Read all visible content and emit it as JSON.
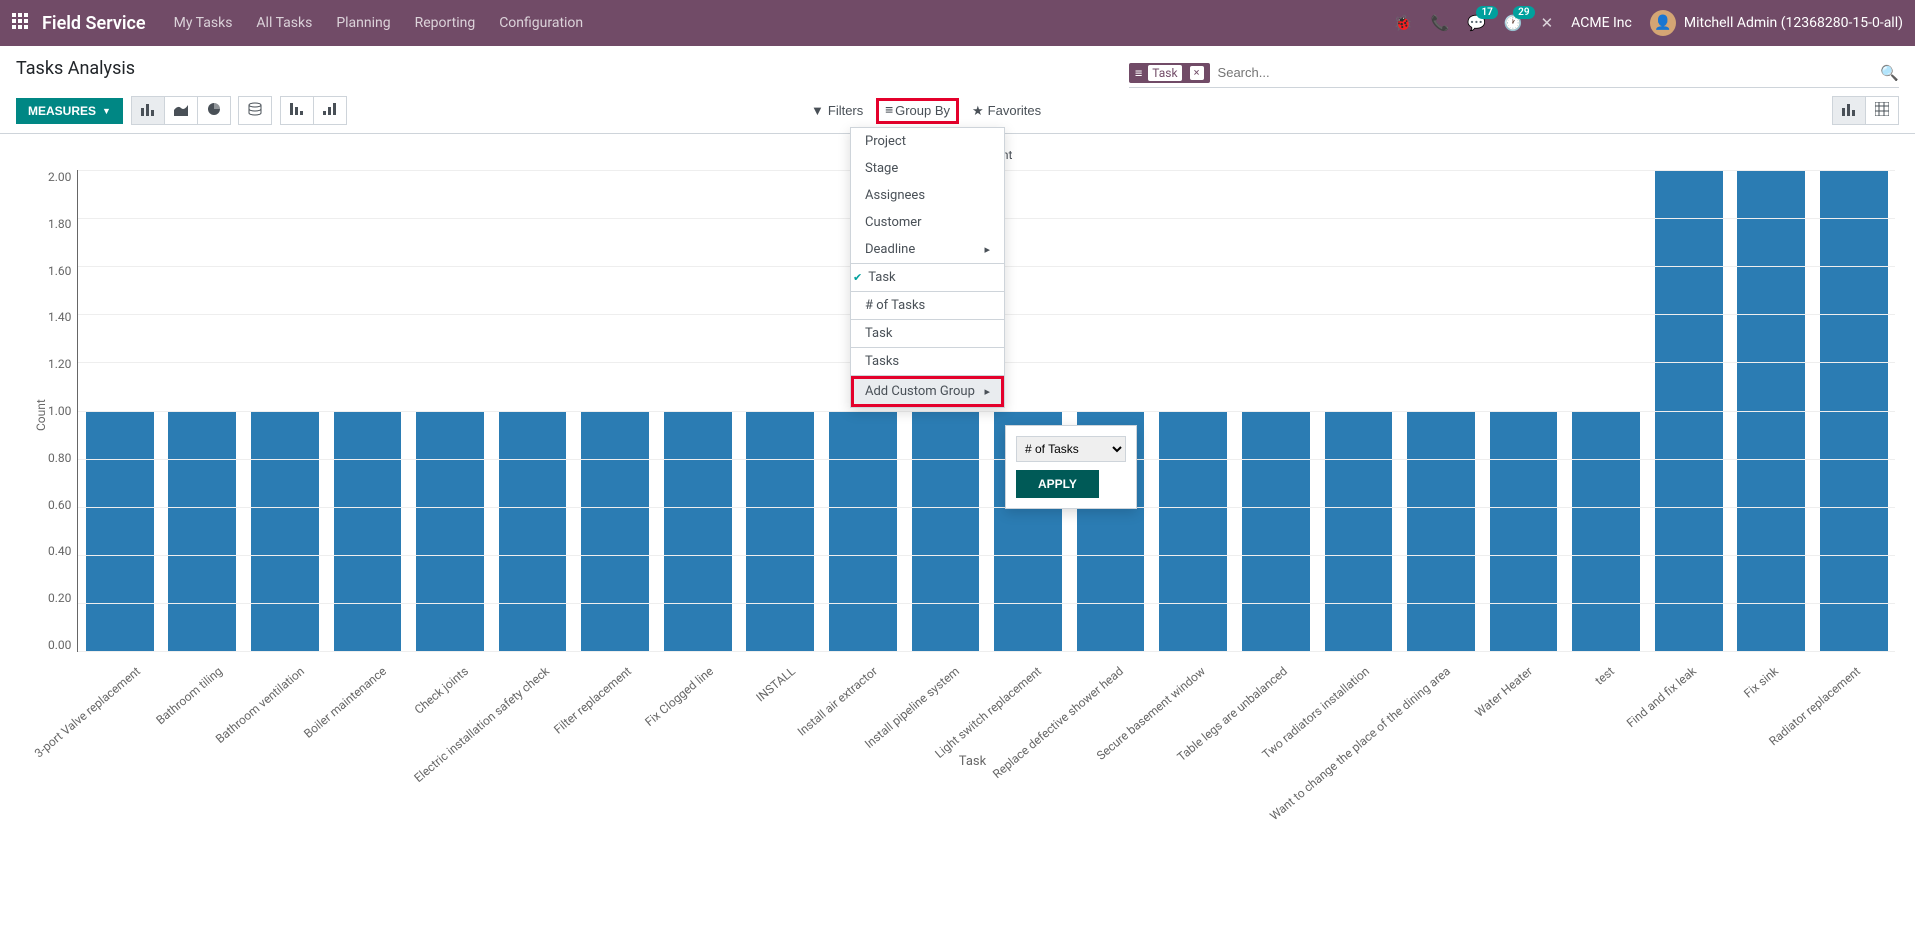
{
  "nav": {
    "brand": "Field Service",
    "items": [
      "My Tasks",
      "All Tasks",
      "Planning",
      "Reporting",
      "Configuration"
    ],
    "badges": {
      "messages": "17",
      "activities": "29"
    },
    "company": "ACME Inc",
    "user": "Mitchell Admin (12368280-15-0-all)"
  },
  "page": {
    "title": "Tasks Analysis",
    "facet": "Task",
    "search_placeholder": "Search...",
    "measures": "MEASURES",
    "filters": "Filters",
    "group_by": "Group By",
    "favorites": "Favorites"
  },
  "dropdown": {
    "section1": [
      "Project",
      "Stage",
      "Assignees",
      "Customer",
      "Deadline"
    ],
    "section2_checked": "Task",
    "section3": [
      "# of Tasks",
      "Task",
      "Tasks"
    ],
    "add_custom": "Add Custom Group",
    "custom_field": "# of Tasks",
    "apply": "APPLY"
  },
  "chart_data": {
    "type": "bar",
    "legend": "Count",
    "xlabel": "Task",
    "ylabel": "Count",
    "ylim": [
      0,
      2.0
    ],
    "yticks": [
      "0.00",
      "0.20",
      "0.40",
      "0.60",
      "0.80",
      "1.00",
      "1.20",
      "1.40",
      "1.60",
      "1.80",
      "2.00"
    ],
    "categories": [
      "3-port Valve replacement",
      "Bathroom tiling",
      "Bathroom ventilation",
      "Boiler maintenance",
      "Check joints",
      "Electric installation safety check",
      "Filter replacement",
      "Fix Clogged line",
      "INSTALL",
      "Install air extractor",
      "Install pipeline system",
      "Light switch replacement",
      "Replace defective shower head",
      "Secure basement window",
      "Table legs are unbalanced",
      "Two radiators installation",
      "Want to change the place of the dining area",
      "Water Heater",
      "test",
      "Find and fix leak",
      "Fix sink",
      "Radiator replacement"
    ],
    "values": [
      1,
      1,
      1,
      1,
      1,
      1,
      1,
      1,
      1,
      1,
      1,
      1,
      1,
      1,
      1,
      1,
      1,
      1,
      1,
      2,
      2,
      2
    ]
  }
}
